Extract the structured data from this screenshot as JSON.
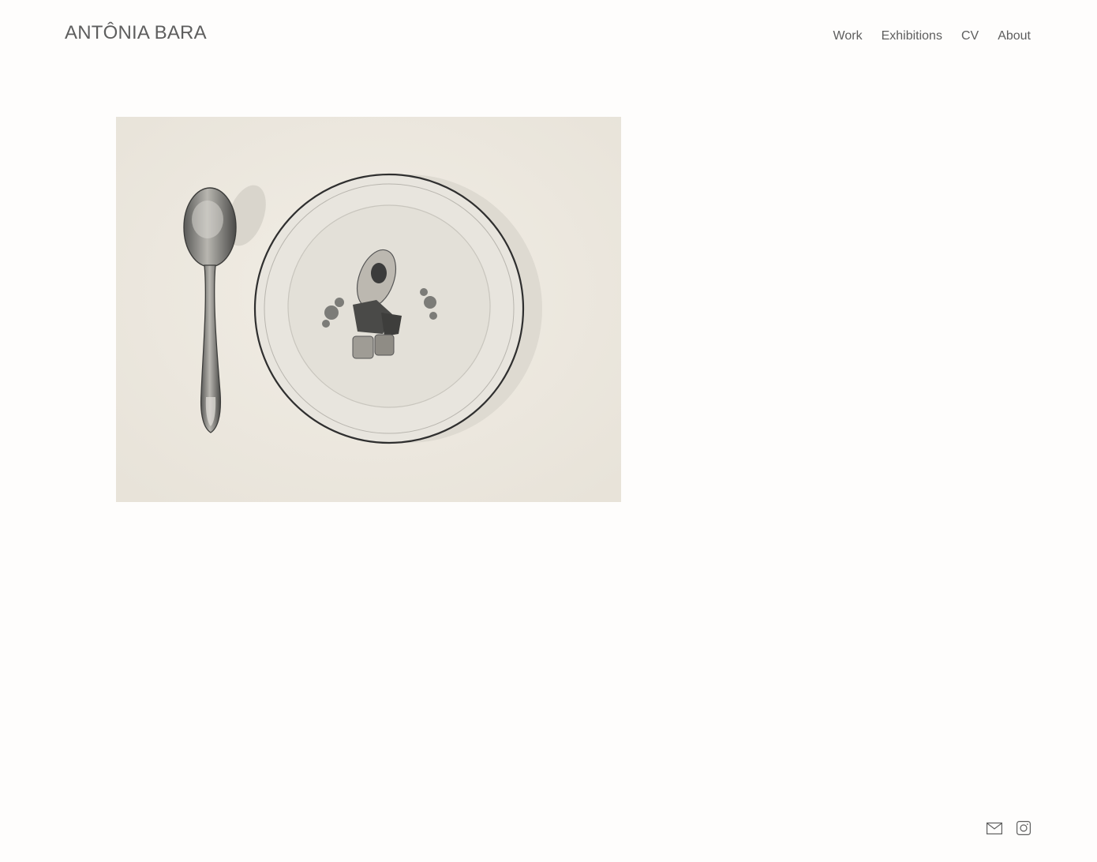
{
  "site": {
    "title": "ANTÔNIA BARA"
  },
  "nav": {
    "items": [
      {
        "label": "Work"
      },
      {
        "label": "Exhibitions"
      },
      {
        "label": "CV"
      },
      {
        "label": "About"
      }
    ]
  },
  "artwork": {
    "icon": "pencil-drawing-spoon-and-plate",
    "colors": {
      "paper": "#ece7dd",
      "graphite": "#3a3a3a",
      "text": "#5e5e5e"
    }
  },
  "footer": {
    "icons": [
      "mail-icon",
      "instagram-icon"
    ]
  }
}
